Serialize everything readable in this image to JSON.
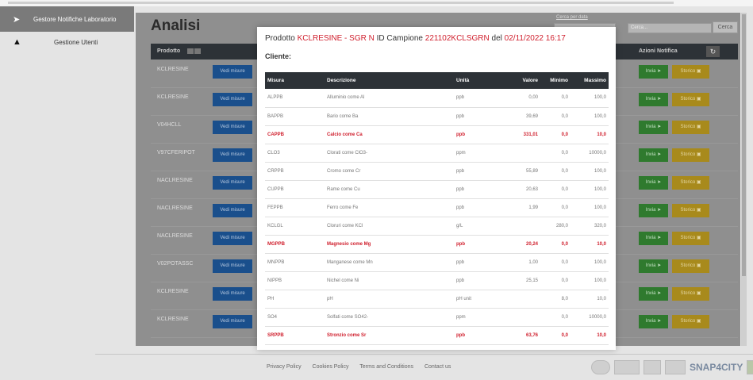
{
  "sidebar": {
    "items": [
      {
        "label": "Gestore Notifiche Laboratorio"
      },
      {
        "label": "Gestione Utenti"
      }
    ]
  },
  "header": {
    "search_date_label": "Cerca per data",
    "search_placeholder": "Cerca...",
    "search_button": "Cerca"
  },
  "main": {
    "title": "Analisi",
    "col_prodotto": "Prodotto",
    "col_azioni": "Azioni Notifica",
    "view_label": "Vedi misure",
    "send_label": "Invia",
    "history_label": "Storico",
    "products": [
      {
        "name": "KCLRESINE"
      },
      {
        "name": "KCLRESINE"
      },
      {
        "name": "V04HCLL"
      },
      {
        "name": "V97CFERIPOT"
      },
      {
        "name": "NACLRESINE"
      },
      {
        "name": "NACLRESINE"
      },
      {
        "name": "NACLRESINE"
      },
      {
        "name": "V02POTASSC"
      },
      {
        "name": "KCLRESINE"
      },
      {
        "name": "KCLRESINE"
      }
    ]
  },
  "modal": {
    "title_prefix": "Prodotto",
    "product": "KCLRESINE - SGR N",
    "id_label": "ID Campione",
    "sample_id": "221102KCLSGRN",
    "date_label": "del",
    "date": "02/11/2022 16:17",
    "client_label": "Cliente:",
    "columns": [
      "Misura",
      "Descrizione",
      "Unità",
      "Valore",
      "Minimo",
      "Massimo"
    ],
    "rows": [
      {
        "misura": "ALPPB",
        "descrizione": "Alluminio come Al",
        "unita": "ppb",
        "valore": "0,00",
        "minimo": "0,0",
        "massimo": "100,0",
        "alert": false
      },
      {
        "misura": "BAPPB",
        "descrizione": "Bario come Ba",
        "unita": "ppb",
        "valore": "39,69",
        "minimo": "0,0",
        "massimo": "100,0",
        "alert": false
      },
      {
        "misura": "CAPPB",
        "descrizione": "Calcio come Ca",
        "unita": "ppb",
        "valore": "331,01",
        "minimo": "0,0",
        "massimo": "10,0",
        "alert": true
      },
      {
        "misura": "CLO3",
        "descrizione": "Clorati come ClO3-",
        "unita": "ppm",
        "valore": "",
        "minimo": "0,0",
        "massimo": "10000,0",
        "alert": false
      },
      {
        "misura": "CRPPB",
        "descrizione": "Cromo come Cr",
        "unita": "ppb",
        "valore": "55,89",
        "minimo": "0,0",
        "massimo": "100,0",
        "alert": false
      },
      {
        "misura": "CUPPB",
        "descrizione": "Rame come Cu",
        "unita": "ppb",
        "valore": "20,63",
        "minimo": "0,0",
        "massimo": "100,0",
        "alert": false
      },
      {
        "misura": "FEPPB",
        "descrizione": "Ferro come Fe",
        "unita": "ppb",
        "valore": "1,99",
        "minimo": "0,0",
        "massimo": "100,0",
        "alert": false
      },
      {
        "misura": "KCLGL",
        "descrizione": "Cloruri come KCl",
        "unita": "g/L",
        "valore": "",
        "minimo": "280,0",
        "massimo": "320,0",
        "alert": false
      },
      {
        "misura": "MGPPB",
        "descrizione": "Magnesio come Mg",
        "unita": "ppb",
        "valore": "20,24",
        "minimo": "0,0",
        "massimo": "10,0",
        "alert": true
      },
      {
        "misura": "MNPPB",
        "descrizione": "Manganese come Mn",
        "unita": "ppb",
        "valore": "1,00",
        "minimo": "0,0",
        "massimo": "100,0",
        "alert": false
      },
      {
        "misura": "NIPPB",
        "descrizione": "Nichel come Ni",
        "unita": "ppb",
        "valore": "25,15",
        "minimo": "0,0",
        "massimo": "100,0",
        "alert": false
      },
      {
        "misura": "PH",
        "descrizione": "pH",
        "unita": "pH unit",
        "valore": "",
        "minimo": "8,0",
        "massimo": "10,0",
        "alert": false
      },
      {
        "misura": "SO4",
        "descrizione": "Solfati come SO42-",
        "unita": "ppm",
        "valore": "",
        "minimo": "0,0",
        "massimo": "10000,0",
        "alert": false
      },
      {
        "misura": "SRPPB",
        "descrizione": "Stronzio come Sr",
        "unita": "ppb",
        "valore": "63,76",
        "minimo": "0,0",
        "massimo": "10,0",
        "alert": true
      }
    ]
  },
  "footer": {
    "links": [
      "Privacy Policy",
      "Cookies Policy",
      "Terms and Conditions",
      "Contact us"
    ],
    "brand": "SNAP4CITY"
  },
  "colors": {
    "alert": "#d0202e",
    "table_header": "#2d3237",
    "view_button": "#1a4f8c",
    "send_button": "#2f7a2e",
    "history_button": "#a88a1c"
  },
  "icons": [
    "send-arrow-icon",
    "up-arrow-icon",
    "refresh-icon",
    "send-icon",
    "history-icon"
  ]
}
